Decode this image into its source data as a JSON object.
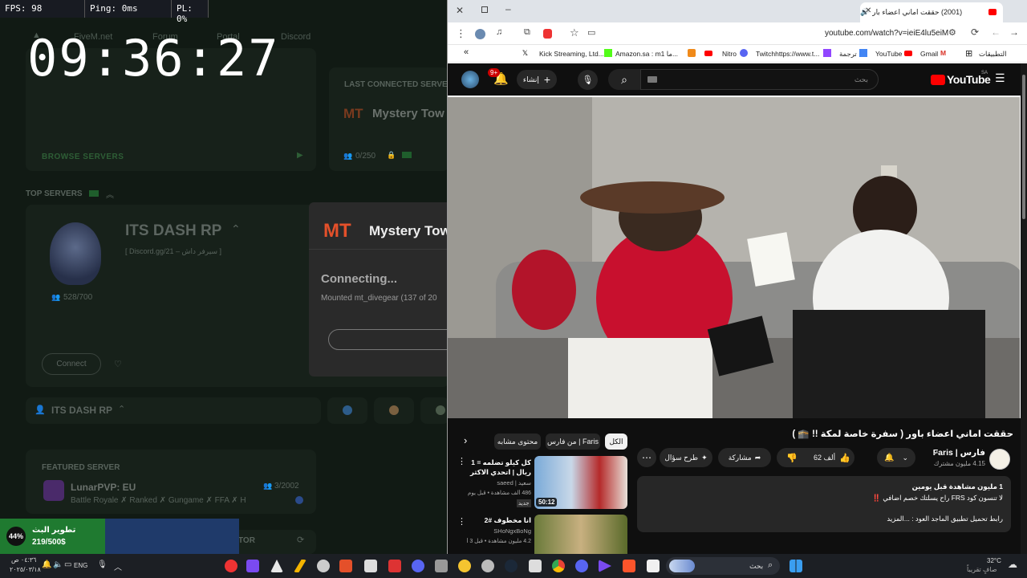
{
  "overlay": {
    "fps": "FPS: 98",
    "ping": "Ping: 0ms",
    "pl": "PL: 0%",
    "clock": "09:36:27"
  },
  "launcher": {
    "nav": [
      "FiveM.net",
      "Forum",
      "Portal",
      "Discord"
    ],
    "browse_servers": "BROWSE SERVERS",
    "last_connected_label": "LAST CONNECTED SERVER",
    "last_connected_name": "Mystery Tow",
    "last_connected_players": "0/250",
    "top_servers_label": "TOP SERVERS",
    "top_server": {
      "name": "ITS DASH RP",
      "desc": "[ Discord.gg/21 – سيرفر داش ]",
      "players": "528/700",
      "connect": "Connect"
    },
    "list_server_name": "ITS DASH RP",
    "featured_label": "FEATURED SERVER",
    "featured": {
      "name": "LunarPVP: EU",
      "desc": "Battle Royale ✗ Ranked ✗ Gungame ✗ FFA ✗ H",
      "players": "3/2002"
    },
    "partial_label": "TOR",
    "connecting": {
      "server": "Mystery Tow",
      "title": "Connecting...",
      "status": "Mounted mt_divegear (137 of 20"
    },
    "donation": {
      "percent": "44%",
      "title": "تطوير البث",
      "amount": "219/500$",
      "progress": 0.44
    }
  },
  "browser": {
    "tab_title": "(2001) حققت اماني اعضاء بار",
    "url": "youtube.com/watch?v=ieiE4lu5eiM",
    "bookmarks": [
      "Kick Streaming, Ltd....",
      "Amazon.sa : m1 ما...",
      "Nitro",
      "Twitchhttps://www.t...",
      "ترجمة",
      "YouTube",
      "Gmail",
      "التطبيقات"
    ],
    "yt": {
      "logo": "YouTube",
      "logo_region": "SA",
      "search_placeholder": "بحث",
      "create": "إنشاء",
      "notif_count": "9+",
      "video_title": "حققت اماني اعضاء باور ( سفرة خاصة لمكة !! 🕋 )",
      "channel": "فارس | Faris",
      "subscribers": "4.15 مليون مشترك",
      "likes": "62 ألف",
      "share": "مشاركة",
      "ask": "طرح سؤال",
      "desc_line1": "1 مليون مشاهدة  قبل يومين",
      "desc_line2": "لا تنسون كود FRS راح يسلتك خصم اضافي ‼️",
      "desc_line3": "رابط تحميل تطبيق الماجد العود :  ...المزيد",
      "chips": [
        "الكل",
        "من فارس | Faris",
        "محتوى مشابه"
      ],
      "recs": [
        {
          "title": "كل كيلو تضلمه = 1 ريال | اتحدي الاكثر على سر...",
          "channel": "سعيد | saeed",
          "meta": "486 ألف مشاهدة • قبل يوم واحد",
          "badge": "جديد",
          "duration": "50:12"
        },
        {
          "title": "انا مخطوف #2",
          "channel": "SHoNgxBoNg",
          "meta": "4.2 مليون مشاهدة • قبل 3 أشهر",
          "badge": "",
          "duration": ""
        }
      ]
    }
  },
  "taskbar": {
    "time": "٠٤:٣٦ ص",
    "date": "٢٠٢٥/٠٣/١٨",
    "lang": "ENG",
    "search": "بحث",
    "weather_temp": "32°C",
    "weather_desc": "صافٍ تقريباً",
    "colors": {
      "youtube_red": "#ff0000",
      "twitch": "#9146ff",
      "kick": "#53fc18"
    }
  }
}
